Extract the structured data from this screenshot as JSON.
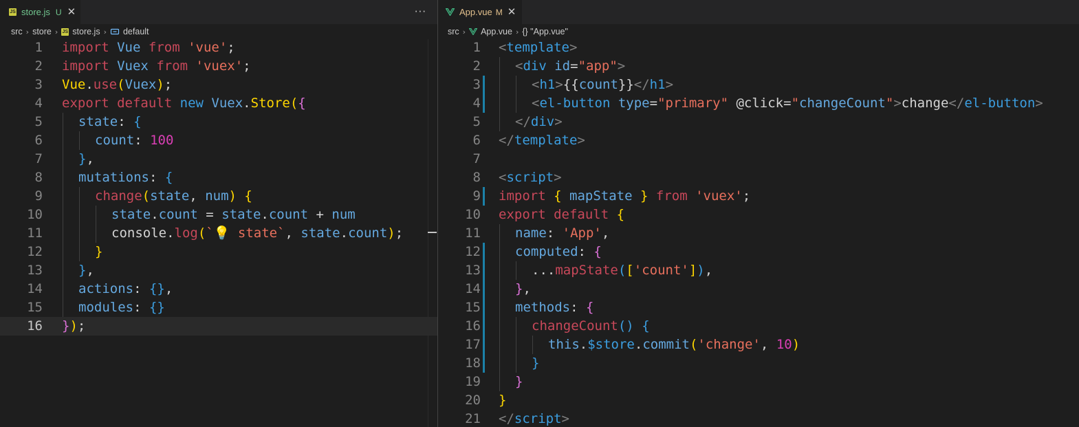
{
  "colors": {
    "keyword": "#c8485a",
    "string": "#e8705d",
    "ident": "#65a9e0",
    "yellow": "#ffd700",
    "pink": "#da70d6",
    "blue": "#3c9ee0",
    "plain": "#d4d4d4",
    "number": "#da3fb5",
    "tag": "#808080",
    "vue_green": "#41b883"
  },
  "left_editor": {
    "tab": {
      "label": "store.js",
      "badge": "U",
      "icon": "js-file-icon"
    },
    "more_icon": "more-actions-icon",
    "breadcrumb": [
      "src",
      "store",
      "store.js",
      "default"
    ],
    "current_line": 16,
    "lines": [
      {
        "n": "1",
        "indent": 0,
        "t": [
          [
            "import",
            "keyword"
          ],
          [
            " ",
            "plain"
          ],
          [
            "Vue",
            "ident"
          ],
          [
            " ",
            "plain"
          ],
          [
            "from",
            "keyword"
          ],
          [
            " ",
            "plain"
          ],
          [
            "'vue'",
            "string"
          ],
          [
            ";",
            "plain"
          ]
        ]
      },
      {
        "n": "2",
        "indent": 0,
        "t": [
          [
            "import",
            "keyword"
          ],
          [
            " ",
            "plain"
          ],
          [
            "Vuex",
            "ident"
          ],
          [
            " ",
            "plain"
          ],
          [
            "from",
            "keyword"
          ],
          [
            " ",
            "plain"
          ],
          [
            "'vuex'",
            "string"
          ],
          [
            ";",
            "plain"
          ]
        ]
      },
      {
        "n": "3",
        "indent": 0,
        "t": [
          [
            "Vue",
            "yellow"
          ],
          [
            ".",
            "plain"
          ],
          [
            "use",
            "keyword"
          ],
          [
            "(",
            "yellow"
          ],
          [
            "Vuex",
            "ident"
          ],
          [
            ")",
            "yellow"
          ],
          [
            ";",
            "plain"
          ]
        ]
      },
      {
        "n": "4",
        "indent": 0,
        "t": [
          [
            "export",
            "keyword"
          ],
          [
            " ",
            "plain"
          ],
          [
            "default",
            "keyword"
          ],
          [
            " ",
            "plain"
          ],
          [
            "new",
            "blue"
          ],
          [
            " ",
            "plain"
          ],
          [
            "Vuex",
            "ident"
          ],
          [
            ".",
            "plain"
          ],
          [
            "Store",
            "yellow"
          ],
          [
            "(",
            "yellow"
          ],
          [
            "{",
            "pink"
          ]
        ]
      },
      {
        "n": "5",
        "indent": 1,
        "t": [
          [
            "state",
            "ident"
          ],
          [
            ": ",
            "plain"
          ],
          [
            "{",
            "blue"
          ]
        ]
      },
      {
        "n": "6",
        "indent": 2,
        "t": [
          [
            "count",
            "ident"
          ],
          [
            ": ",
            "plain"
          ],
          [
            "100",
            "number"
          ]
        ]
      },
      {
        "n": "7",
        "indent": 1,
        "t": [
          [
            "}",
            "blue"
          ],
          [
            ",",
            "plain"
          ]
        ]
      },
      {
        "n": "8",
        "indent": 1,
        "t": [
          [
            "mutations",
            "ident"
          ],
          [
            ": ",
            "plain"
          ],
          [
            "{",
            "blue"
          ]
        ]
      },
      {
        "n": "9",
        "indent": 2,
        "t": [
          [
            "change",
            "keyword"
          ],
          [
            "(",
            "yellow"
          ],
          [
            "state",
            "ident"
          ],
          [
            ", ",
            "plain"
          ],
          [
            "num",
            "ident"
          ],
          [
            ")",
            "yellow"
          ],
          [
            " ",
            "plain"
          ],
          [
            "{",
            "yellow"
          ]
        ]
      },
      {
        "n": "10",
        "indent": 3,
        "t": [
          [
            "state",
            "ident"
          ],
          [
            ".",
            "plain"
          ],
          [
            "count",
            "ident"
          ],
          [
            " = ",
            "plain"
          ],
          [
            "state",
            "ident"
          ],
          [
            ".",
            "plain"
          ],
          [
            "count",
            "ident"
          ],
          [
            " + ",
            "plain"
          ],
          [
            "num",
            "ident"
          ]
        ]
      },
      {
        "n": "11",
        "indent": 3,
        "t": [
          [
            "console",
            "plain"
          ],
          [
            ".",
            "plain"
          ],
          [
            "log",
            "keyword"
          ],
          [
            "(",
            "yellow"
          ],
          [
            "`",
            "string"
          ],
          [
            "💡",
            "bulb"
          ],
          [
            " state`",
            "string"
          ],
          [
            ", ",
            "plain"
          ],
          [
            "state",
            "ident"
          ],
          [
            ".",
            "plain"
          ],
          [
            "count",
            "ident"
          ],
          [
            ")",
            "yellow"
          ],
          [
            ";",
            "plain"
          ]
        ]
      },
      {
        "n": "12",
        "indent": 2,
        "t": [
          [
            "}",
            "yellow"
          ]
        ]
      },
      {
        "n": "13",
        "indent": 1,
        "t": [
          [
            "}",
            "blue"
          ],
          [
            ",",
            "plain"
          ]
        ]
      },
      {
        "n": "14",
        "indent": 1,
        "t": [
          [
            "actions",
            "ident"
          ],
          [
            ": ",
            "plain"
          ],
          [
            "{}",
            "blue"
          ],
          [
            ",",
            "plain"
          ]
        ]
      },
      {
        "n": "15",
        "indent": 1,
        "t": [
          [
            "modules",
            "ident"
          ],
          [
            ": ",
            "plain"
          ],
          [
            "{}",
            "blue"
          ]
        ]
      },
      {
        "n": "16",
        "indent": 0,
        "t": [
          [
            "}",
            "pink"
          ],
          [
            ")",
            "yellow"
          ],
          [
            ";",
            "plain"
          ]
        ]
      }
    ]
  },
  "right_editor": {
    "tab": {
      "label": "App.vue",
      "badge": "M",
      "icon": "vue-file-icon"
    },
    "breadcrumb": [
      "src",
      "App.vue",
      "{} \"App.vue\""
    ],
    "lines": [
      {
        "n": "1",
        "indent": 0,
        "t": [
          [
            "<",
            "tag"
          ],
          [
            "template",
            "blue"
          ],
          [
            ">",
            "tag"
          ]
        ]
      },
      {
        "n": "2",
        "indent": 1,
        "t": [
          [
            "<",
            "tag"
          ],
          [
            "div",
            "blue"
          ],
          [
            " ",
            "plain"
          ],
          [
            "id",
            "ident"
          ],
          [
            "=",
            "plain"
          ],
          [
            "\"app\"",
            "string"
          ],
          [
            ">",
            "tag"
          ]
        ]
      },
      {
        "n": "3",
        "indent": 2,
        "mod": true,
        "t": [
          [
            "<",
            "tag"
          ],
          [
            "h1",
            "blue"
          ],
          [
            ">",
            "tag"
          ],
          [
            "{{",
            "plain"
          ],
          [
            "count",
            "ident"
          ],
          [
            "}}",
            "plain"
          ],
          [
            "</",
            "tag"
          ],
          [
            "h1",
            "blue"
          ],
          [
            ">",
            "tag"
          ]
        ]
      },
      {
        "n": "4",
        "indent": 2,
        "mod": true,
        "t": [
          [
            "<",
            "tag"
          ],
          [
            "el-button",
            "blue"
          ],
          [
            " ",
            "plain"
          ],
          [
            "type",
            "ident"
          ],
          [
            "=",
            "plain"
          ],
          [
            "\"primary\"",
            "string"
          ],
          [
            " ",
            "plain"
          ],
          [
            "@click",
            "plain"
          ],
          [
            "=",
            "plain"
          ],
          [
            "\"",
            "string"
          ],
          [
            "changeCount",
            "ident"
          ],
          [
            "\"",
            "string"
          ],
          [
            ">",
            "tag"
          ],
          [
            "change",
            "plain"
          ],
          [
            "</",
            "tag"
          ],
          [
            "el-button",
            "blue"
          ],
          [
            ">",
            "tag"
          ]
        ]
      },
      {
        "n": "5",
        "indent": 1,
        "t": [
          [
            "</",
            "tag"
          ],
          [
            "div",
            "blue"
          ],
          [
            ">",
            "tag"
          ]
        ]
      },
      {
        "n": "6",
        "indent": 0,
        "t": [
          [
            "</",
            "tag"
          ],
          [
            "template",
            "blue"
          ],
          [
            ">",
            "tag"
          ]
        ]
      },
      {
        "n": "7",
        "indent": 0,
        "t": []
      },
      {
        "n": "8",
        "indent": 0,
        "t": [
          [
            "<",
            "tag"
          ],
          [
            "script",
            "blue"
          ],
          [
            ">",
            "tag"
          ]
        ]
      },
      {
        "n": "9",
        "indent": 0,
        "mod": true,
        "t": [
          [
            "import",
            "keyword"
          ],
          [
            " ",
            "plain"
          ],
          [
            "{",
            "yellow"
          ],
          [
            " ",
            "plain"
          ],
          [
            "mapState",
            "ident"
          ],
          [
            " ",
            "plain"
          ],
          [
            "}",
            "yellow"
          ],
          [
            " ",
            "plain"
          ],
          [
            "from",
            "keyword"
          ],
          [
            " ",
            "plain"
          ],
          [
            "'vuex'",
            "string"
          ],
          [
            ";",
            "plain"
          ]
        ]
      },
      {
        "n": "10",
        "indent": 0,
        "t": [
          [
            "export",
            "keyword"
          ],
          [
            " ",
            "plain"
          ],
          [
            "default",
            "keyword"
          ],
          [
            " ",
            "plain"
          ],
          [
            "{",
            "yellow"
          ]
        ]
      },
      {
        "n": "11",
        "indent": 1,
        "t": [
          [
            "name",
            "ident"
          ],
          [
            ": ",
            "plain"
          ],
          [
            "'App'",
            "string"
          ],
          [
            ",",
            "plain"
          ]
        ]
      },
      {
        "n": "12",
        "indent": 1,
        "mod": true,
        "t": [
          [
            "computed",
            "ident"
          ],
          [
            ": ",
            "plain"
          ],
          [
            "{",
            "pink"
          ]
        ]
      },
      {
        "n": "13",
        "indent": 2,
        "mod": true,
        "t": [
          [
            "...",
            "plain"
          ],
          [
            "mapState",
            "keyword"
          ],
          [
            "(",
            "blue"
          ],
          [
            "[",
            "yellow"
          ],
          [
            "'count'",
            "string"
          ],
          [
            "]",
            "yellow"
          ],
          [
            ")",
            "blue"
          ],
          [
            ",",
            "plain"
          ]
        ]
      },
      {
        "n": "14",
        "indent": 1,
        "mod": true,
        "t": [
          [
            "}",
            "pink"
          ],
          [
            ",",
            "plain"
          ]
        ]
      },
      {
        "n": "15",
        "indent": 1,
        "mod": true,
        "t": [
          [
            "methods",
            "ident"
          ],
          [
            ": ",
            "plain"
          ],
          [
            "{",
            "pink"
          ]
        ]
      },
      {
        "n": "16",
        "indent": 2,
        "mod": true,
        "t": [
          [
            "changeCount",
            "keyword"
          ],
          [
            "()",
            "blue"
          ],
          [
            " ",
            "plain"
          ],
          [
            "{",
            "blue"
          ]
        ]
      },
      {
        "n": "17",
        "indent": 3,
        "mod": true,
        "t": [
          [
            "this",
            "ident"
          ],
          [
            ".",
            "plain"
          ],
          [
            "$store",
            "blue"
          ],
          [
            ".",
            "plain"
          ],
          [
            "commit",
            "ident"
          ],
          [
            "(",
            "yellow"
          ],
          [
            "'change'",
            "string"
          ],
          [
            ", ",
            "plain"
          ],
          [
            "10",
            "number"
          ],
          [
            ")",
            "yellow"
          ]
        ]
      },
      {
        "n": "18",
        "indent": 2,
        "mod": true,
        "t": [
          [
            "}",
            "blue"
          ]
        ]
      },
      {
        "n": "19",
        "indent": 1,
        "t": [
          [
            "}",
            "pink"
          ]
        ]
      },
      {
        "n": "20",
        "indent": 0,
        "t": [
          [
            "}",
            "yellow"
          ]
        ]
      },
      {
        "n": "21",
        "indent": 0,
        "t": [
          [
            "</",
            "tag"
          ],
          [
            "script",
            "blue"
          ],
          [
            ">",
            "tag"
          ]
        ]
      }
    ]
  }
}
